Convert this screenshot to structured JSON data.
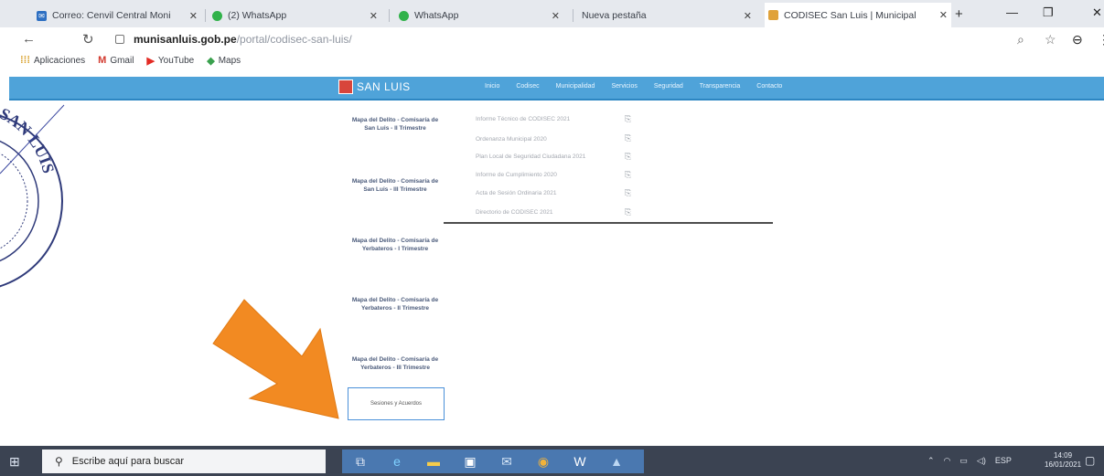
{
  "tabs": [
    {
      "title": "Correo: Cenvil Central Moni",
      "color": "#2d6fc2"
    },
    {
      "title": "(2) WhatsApp",
      "color": "#31b24a"
    },
    {
      "title": "WhatsApp",
      "color": "#31b24a"
    },
    {
      "title": "Nueva pestaña",
      "color": ""
    },
    {
      "title": "CODISEC San Luis | Municipal",
      "color": "#e0a23a"
    }
  ],
  "address": {
    "domain": "munisanluis.gob.pe",
    "path": "/portal/codisec-san-luis/"
  },
  "bookmarks": [
    "Aplicaciones",
    "Gmail",
    "YouTube",
    "Maps"
  ],
  "site": {
    "logo": "SAN LUIS",
    "nav": [
      "Inicio",
      "Codisec",
      "Municipalidad",
      "Servicios",
      "Seguridad",
      "Transparencia",
      "Contacto"
    ]
  },
  "left_items": [
    "Mapa del Delito - Comisaría de San Luis - II Trimestre",
    "Mapa del Delito - Comisaría de San Luis - III Trimestre",
    "Mapa del Delito - Comisaría de Yerbateros - I Trimestre",
    "Mapa del Delito - Comisaría de Yerbateros - II Trimestre",
    "Mapa del Delito - Comisaría de Yerbateros - III Trimestre"
  ],
  "left_box": "Sesiones y Acuerdos",
  "right_items": [
    "Informe Técnico de CODISEC 2021",
    "Ordenanza Municipal 2020",
    "Plan Local de Seguridad Ciudadana 2021",
    "Informe de Cumplimiento 2020",
    "Acta de Sesión Ordinaria 2021",
    "Directorio de CODISEC 2021"
  ],
  "stamp": {
    "text": "DE SAN LUIS"
  },
  "taskbar": {
    "search_placeholder": "Escribe aquí para buscar",
    "lang": "ESP",
    "time": "14:09",
    "date": "16/01/2021"
  }
}
